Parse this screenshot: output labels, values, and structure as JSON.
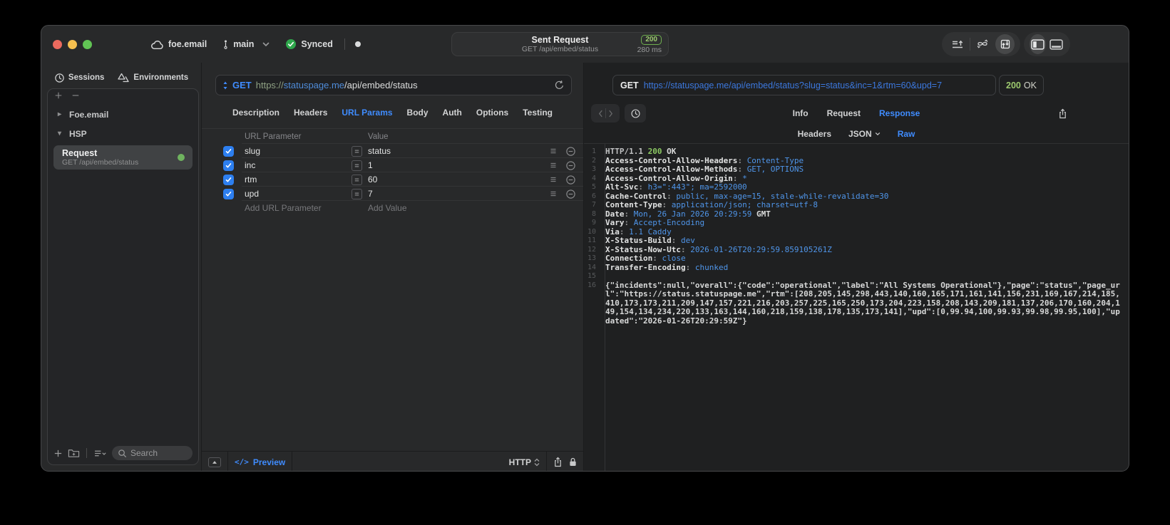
{
  "colors": {
    "accent": "#3f8cff",
    "green": "#8cc963",
    "urlblue": "#4f95e9",
    "checkbox": "#2d7ff0"
  },
  "titlebar": {
    "project": "foe.email",
    "branch": "main",
    "sync": "Synced",
    "summary": {
      "title": "Sent Request",
      "subtitle": "GET /api/embed/status",
      "status_code": "200",
      "duration": "280 ms"
    }
  },
  "sidebar": {
    "tabs": [
      {
        "label": "Sessions"
      },
      {
        "label": "Environments"
      }
    ],
    "groups": [
      {
        "label": "Foe.email"
      },
      {
        "label": "HSP"
      }
    ],
    "request": {
      "title": "Request",
      "subtitle": "GET /api/embed/status"
    },
    "search_placeholder": "Search"
  },
  "editor": {
    "method": "GET",
    "url": {
      "scheme": "https://",
      "host": "statuspage.me",
      "path": "/api/embed/status"
    },
    "tabs": [
      "Description",
      "Headers",
      "URL Params",
      "Body",
      "Auth",
      "Options",
      "Testing"
    ],
    "active_tab": "URL Params",
    "table": {
      "headers": [
        "URL Parameter",
        "Value"
      ],
      "rows": [
        {
          "name": "slug",
          "value": "status",
          "enabled": true
        },
        {
          "name": "inc",
          "value": "1",
          "enabled": true
        },
        {
          "name": "rtm",
          "value": "60",
          "enabled": true
        },
        {
          "name": "upd",
          "value": "7",
          "enabled": true
        }
      ],
      "add_row": {
        "name": "Add URL Parameter",
        "value": "Add Value"
      }
    },
    "bottom": {
      "code_glyph": "</>",
      "preview": "Preview",
      "protocol": "HTTP"
    }
  },
  "response": {
    "method": "GET",
    "url": "https://statuspage.me/api/embed/status?slug=status&inc=1&rtm=60&upd=7",
    "status_code": "200",
    "status_text": "OK",
    "tabs": [
      "Info",
      "Request",
      "Response"
    ],
    "active_tab": "Response",
    "subtabs": [
      "Headers",
      "JSON",
      "Raw"
    ],
    "active_subtab": "Raw",
    "body_lines": [
      {
        "n": "1",
        "segs": [
          [
            "d",
            "HTTP/1.1 "
          ],
          [
            "g",
            "200"
          ],
          [
            "w",
            " OK"
          ]
        ]
      },
      {
        "n": "2",
        "segs": [
          [
            "k",
            "Access-Control-Allow-Headers"
          ],
          [
            "p",
            ": "
          ],
          [
            "v",
            "Content-Type"
          ]
        ]
      },
      {
        "n": "3",
        "segs": [
          [
            "k",
            "Access-Control-Allow-Methods"
          ],
          [
            "p",
            ": "
          ],
          [
            "v",
            "GET, OPTIONS"
          ]
        ]
      },
      {
        "n": "4",
        "segs": [
          [
            "k",
            "Access-Control-Allow-Origin"
          ],
          [
            "p",
            ": "
          ],
          [
            "v",
            "*"
          ]
        ]
      },
      {
        "n": "5",
        "segs": [
          [
            "k",
            "Alt-Svc"
          ],
          [
            "p",
            ": "
          ],
          [
            "v",
            "h3=\":443\"; ma=2592000"
          ]
        ]
      },
      {
        "n": "6",
        "segs": [
          [
            "k",
            "Cache-Control"
          ],
          [
            "p",
            ": "
          ],
          [
            "v",
            "public, max-age=15, stale-while-revalidate=30"
          ]
        ]
      },
      {
        "n": "7",
        "segs": [
          [
            "k",
            "Content-Type"
          ],
          [
            "p",
            ": "
          ],
          [
            "v",
            "application/json; charset=utf-8"
          ]
        ]
      },
      {
        "n": "8",
        "segs": [
          [
            "k",
            "Date"
          ],
          [
            "p",
            ": "
          ],
          [
            "v",
            "Mon, 26 Jan 2026 20:29:59"
          ],
          [
            "w",
            " GMT"
          ]
        ]
      },
      {
        "n": "9",
        "segs": [
          [
            "k",
            "Vary"
          ],
          [
            "p",
            ": "
          ],
          [
            "v",
            "Accept-Encoding"
          ]
        ]
      },
      {
        "n": "10",
        "segs": [
          [
            "k",
            "Via"
          ],
          [
            "p",
            ": "
          ],
          [
            "v",
            "1.1 Caddy"
          ]
        ]
      },
      {
        "n": "11",
        "segs": [
          [
            "k",
            "X-Status-Build"
          ],
          [
            "p",
            ": "
          ],
          [
            "v",
            "dev"
          ]
        ]
      },
      {
        "n": "12",
        "segs": [
          [
            "k",
            "X-Status-Now-Utc"
          ],
          [
            "p",
            ": "
          ],
          [
            "v",
            "2026-01-26T20:29:59.859105261Z"
          ]
        ]
      },
      {
        "n": "13",
        "segs": [
          [
            "k",
            "Connection"
          ],
          [
            "p",
            ": "
          ],
          [
            "v",
            "close"
          ]
        ]
      },
      {
        "n": "14",
        "segs": [
          [
            "k",
            "Transfer-Encoding"
          ],
          [
            "p",
            ": "
          ],
          [
            "v",
            "chunked"
          ]
        ]
      },
      {
        "n": "15",
        "segs": []
      },
      {
        "n": "16",
        "segs": [
          [
            "b",
            "{\"incidents\":null,\"overall\":{\"code\":\"operational\",\"label\":\"All Systems Operational\"},\"page\":\"status\",\"page_url\":\"https://status.statuspage.me\",\"rtm\":[208,205,145,298,443,140,160,165,171,161,141,156,231,169,167,214,185,410,173,173,211,209,147,157,221,216,203,257,225,165,250,173,204,223,158,208,143,209,181,137,206,170,160,204,149,154,134,234,220,133,163,144,160,218,159,138,178,135,173,141],\"upd\":[0,99.94,100,99.93,99.98,99.95,100],\"updated\":\"2026-01-26T20:29:59Z\"}"
          ]
        ]
      }
    ]
  }
}
